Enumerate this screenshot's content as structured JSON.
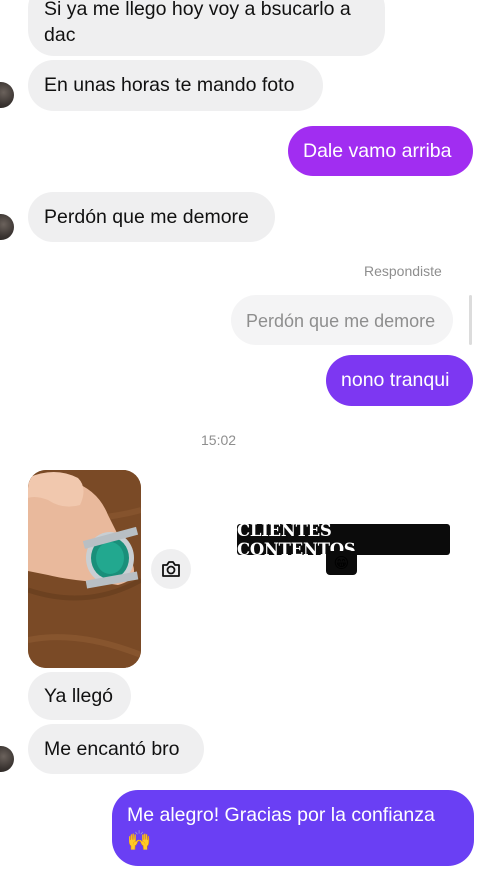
{
  "colors": {
    "incoming_bg": "#efeff0",
    "outgoing_purple": "#a12df1",
    "outgoing_violet": "#7d37f2",
    "outgoing_blue": "#6a3ff4"
  },
  "messages": {
    "m1": "Si ya me llego hoy voy a bsucarlo a\ndac",
    "m2": "En unas horas te mando foto",
    "m3": "Dale vamo arriba",
    "m4": "Perdón que me demore",
    "reply_label": "Respondiste",
    "reply_quote": "Perdón que me demore",
    "m5": "nono tranqui",
    "timestamp": "15:02",
    "m6": "Ya llegó",
    "m7": "Me encantó bro",
    "m8": "Me alegro! Gracias por la confianza\n🙌"
  },
  "overlay": {
    "sticker_text": "CLIENTES CONTENTOS",
    "sticker_emoji": "😁"
  },
  "icons": {
    "reaction": "camera-icon"
  }
}
